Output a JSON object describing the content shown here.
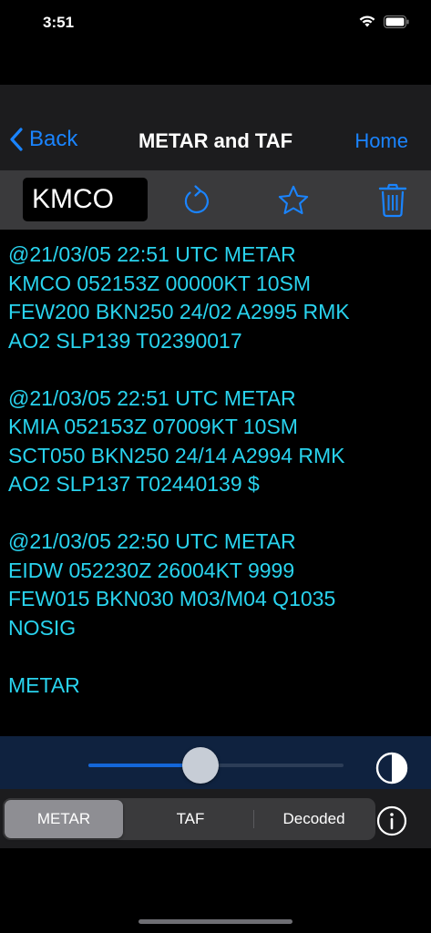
{
  "status": {
    "time": "3:51"
  },
  "nav": {
    "back_label": "Back",
    "title": "METAR and TAF",
    "home_label": "Home"
  },
  "toolbar": {
    "station_value": "KMCO"
  },
  "reports": [
    "@21/03/05 22:51 UTC METAR\nKMCO 052153Z 00000KT 10SM\nFEW200 BKN250 24/02 A2995 RMK\nAO2 SLP139 T02390017",
    "@21/03/05 22:51 UTC METAR\nKMIA 052153Z 07009KT 10SM\nSCT050 BKN250 24/14 A2994 RMK\nAO2 SLP137 T02440139 $",
    "@21/03/05 22:50 UTC METAR\nEIDW 052230Z 26004KT 9999\nFEW015 BKN030 M03/M04 Q1035\nNOSIG",
    "METAR"
  ],
  "slider": {
    "value": 0.44
  },
  "segments": {
    "items": [
      "METAR",
      "TAF",
      "Decoded"
    ],
    "selected": 0
  },
  "colors": {
    "accent": "#1a84ff",
    "report_text": "#29d3ee",
    "slider_fill": "#1467d9"
  }
}
